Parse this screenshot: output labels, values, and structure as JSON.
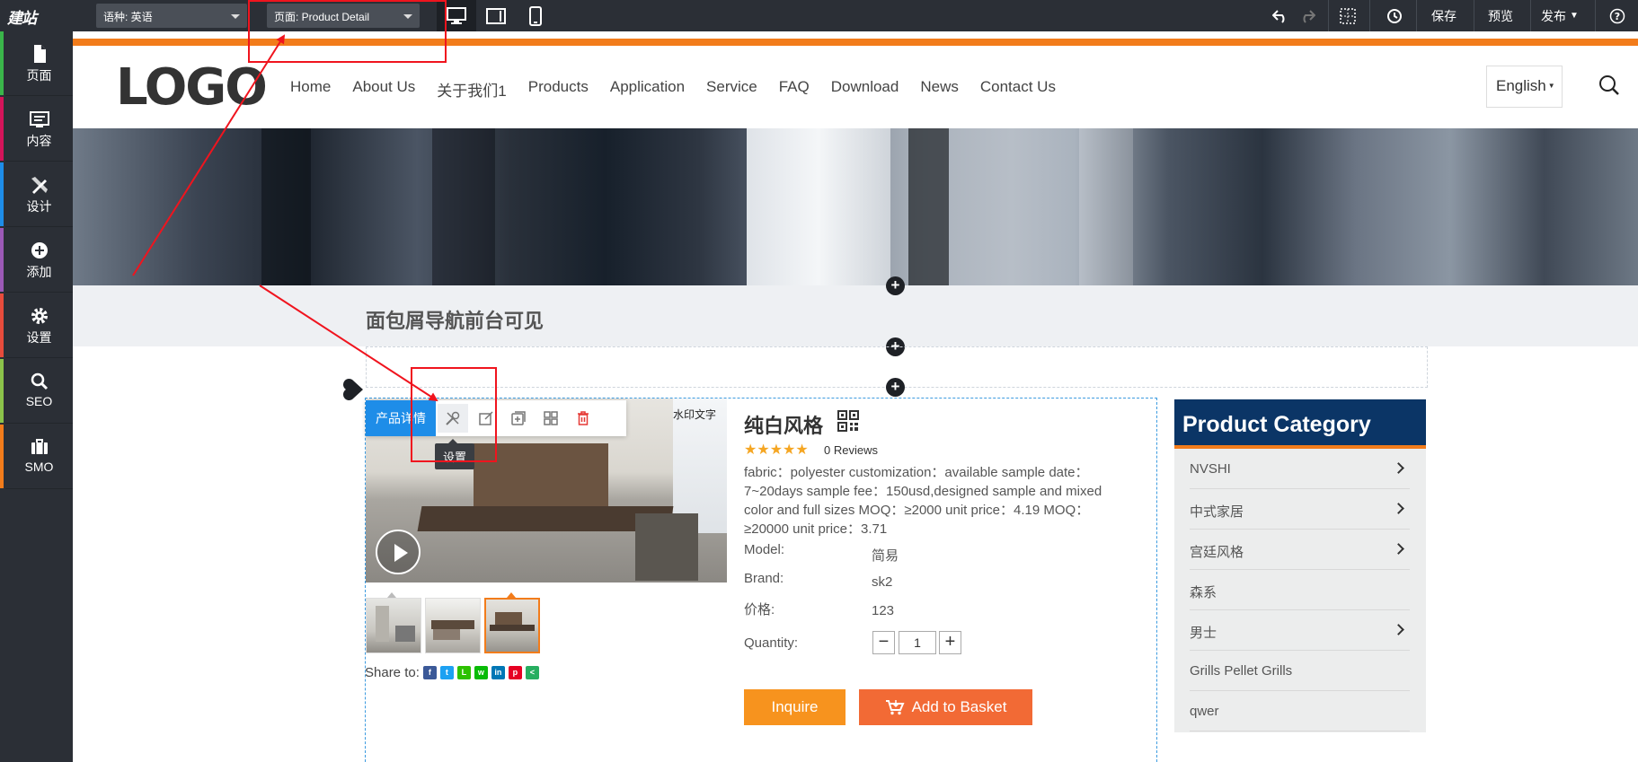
{
  "toolbar": {
    "brand": "建站",
    "language_select": "语种:  英语",
    "page_select": "页面:  Product Detail",
    "save": "保存",
    "preview": "预览",
    "publish": "发布"
  },
  "sidebar": {
    "items": [
      {
        "label": "页面",
        "icon": "page-icon",
        "color": "#3ab54a"
      },
      {
        "label": "内容",
        "icon": "content-icon",
        "color": "#d4145a"
      },
      {
        "label": "设计",
        "icon": "design-icon",
        "color": "#1e8de8"
      },
      {
        "label": "添加",
        "icon": "add-icon",
        "color": "#9b59b6"
      },
      {
        "label": "设置",
        "icon": "settings-icon",
        "color": "#e74c3c"
      },
      {
        "label": "SEO",
        "icon": "seo-icon",
        "color": "#8bc34a"
      },
      {
        "label": "SMO",
        "icon": "smo-icon",
        "color": "#f27c1b"
      }
    ]
  },
  "site": {
    "logo": "LOGO",
    "nav": [
      "Home",
      "About Us",
      "关于我们1",
      "Products",
      "Application",
      "Service",
      "FAQ",
      "Download",
      "News",
      "Contact Us"
    ],
    "language": "English"
  },
  "breadcrumb": "面包屑导航前台可见",
  "module_toolbar": {
    "tab": "产品详情",
    "tooltip": "设置"
  },
  "watermark": "水印文字",
  "product": {
    "title": "纯白风格",
    "reviews": "0 Reviews",
    "stars": "★★★★★",
    "description": "fabric：polyester customization：available sample date：7~20days sample fee：150usd,designed sample and mixed color and full sizes MOQ：≥2000 unit price：4.19 MOQ：≥20000 unit price：3.71",
    "attributes": [
      {
        "label": "Model:",
        "value": "简易"
      },
      {
        "label": "Brand:",
        "value": "sk2"
      },
      {
        "label": "价格:",
        "value": "123"
      }
    ],
    "quantity_label": "Quantity:",
    "quantity": "1",
    "inquire": "Inquire",
    "add_to_basket": "Add to Basket",
    "share_to": "Share to:"
  },
  "category": {
    "title": "Product Category",
    "items": [
      {
        "label": "NVSHI",
        "has_children": true
      },
      {
        "label": "中式家居",
        "has_children": true
      },
      {
        "label": "宫廷风格",
        "has_children": true
      },
      {
        "label": "森系",
        "has_children": false
      },
      {
        "label": "男士",
        "has_children": true
      },
      {
        "label": "Grills Pellet Grills",
        "has_children": false
      },
      {
        "label": "qwer",
        "has_children": false
      }
    ]
  },
  "colors": {
    "toolbar_bg": "#2b2f36",
    "accent_orange": "#f27c1b",
    "category_header": "#0b3566",
    "inquire_btn": "#f7931e",
    "basket_btn": "#f26a35",
    "annotation_red": "#f0141e"
  }
}
